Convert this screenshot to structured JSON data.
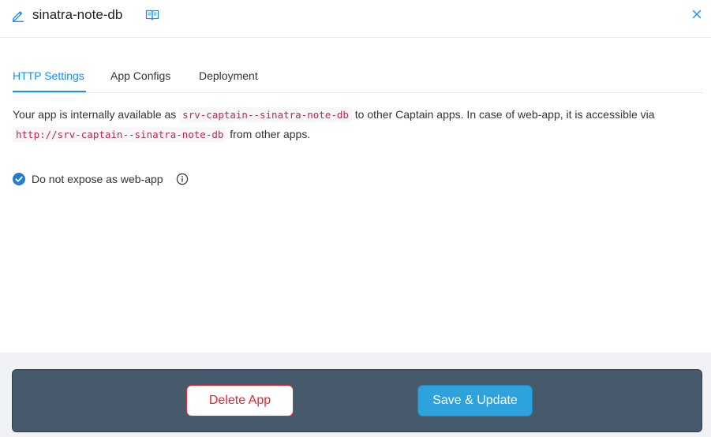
{
  "header": {
    "title": "sinatra-note-db",
    "edit_icon": "pencil-icon",
    "docs_icon": "book-icon",
    "close_icon": "close-icon"
  },
  "tabs": [
    {
      "label": "HTTP Settings",
      "active": true
    },
    {
      "label": "App Configs",
      "active": false
    },
    {
      "label": "Deployment",
      "active": false
    }
  ],
  "http_settings": {
    "desc_part1": "Your app is internally available as ",
    "internal_host": "srv-captain--sinatra-note-db",
    "desc_part2": " to other Captain apps. In case of web-app, it is accessible via ",
    "internal_url": "http://srv-captain--sinatra-note-db",
    "desc_part3": " from other apps.",
    "expose_checkbox": {
      "label": "Do not expose as web-app",
      "checked": true,
      "info_icon": "info-circle-icon"
    }
  },
  "footer": {
    "delete_label": "Delete App",
    "save_label": "Save & Update"
  },
  "colors": {
    "accent": "#1890ff",
    "danger": "#f5222d",
    "primary_button": "#2ea2dc",
    "footer_bg": "#465a6b"
  }
}
